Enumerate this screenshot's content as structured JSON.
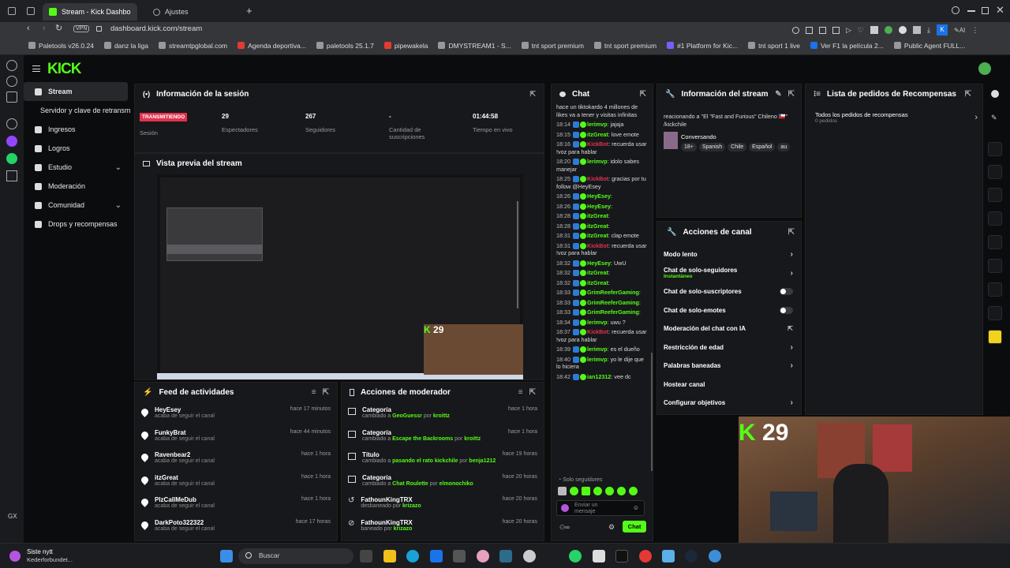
{
  "browser": {
    "tabs": [
      {
        "label": "Stream - Kick Dashbo"
      },
      {
        "label": "Ajustes"
      }
    ],
    "url": "dashboard.kick.com/stream",
    "vpn": "VPN",
    "bookmarks": [
      "Paletools v26.0.24",
      "danz la liga",
      "streamtpglobal.com",
      "Agenda deportiva...",
      "paletools 25.1.7",
      "pipewakela",
      "DMYSTREAM1 - S...",
      "tnt sport premium",
      "tnt sport premium",
      "#1 Platform for Kic...",
      "tnt sport 1 live",
      "Ver F1 la película 2...",
      "Public Agent FULL..."
    ]
  },
  "sidebar": {
    "logo": "KICK",
    "items": [
      {
        "label": "Stream"
      },
      {
        "label": "Servidor y clave de retransmi"
      },
      {
        "label": "Ingresos"
      },
      {
        "label": "Logros"
      },
      {
        "label": "Estudio"
      },
      {
        "label": "Moderación"
      },
      {
        "label": "Comunidad"
      },
      {
        "label": "Drops y recompensas"
      }
    ]
  },
  "session": {
    "title": "Información de la sesión",
    "status": "TRANSMITIENDO",
    "status_label": "Sesión",
    "viewers": "29",
    "viewers_label": "Espectadores",
    "followers": "267",
    "followers_label": "Seguidores",
    "subs": "-",
    "subs_label": "Cantidad de suscripciones",
    "time": "01:44:58",
    "time_label": "Tiempo en vivo"
  },
  "preview": {
    "title": "Vista previa del stream",
    "viewer_count": "29"
  },
  "feed": {
    "title": "Feed de actividades",
    "rows": [
      {
        "name": "HeyEsey",
        "sub": "acaba de seguir el canal",
        "time": "hace 17 minutos"
      },
      {
        "name": "FunkyBrat",
        "sub": "acaba de seguir el canal",
        "time": "hace 44 minutos"
      },
      {
        "name": "Ravenbear2",
        "sub": "acaba de seguir el canal",
        "time": "hace 1 hora"
      },
      {
        "name": "itzGreat",
        "sub": "acaba de seguir el canal",
        "time": "hace 1 hora"
      },
      {
        "name": "PlzCallMeDub",
        "sub": "acaba de seguir el canal",
        "time": "hace 1 hora"
      },
      {
        "name": "DarkPoto322322",
        "sub": "acaba de seguir el canal",
        "time": "hace 17 horas"
      }
    ]
  },
  "modactions": {
    "title": "Acciones de moderador",
    "rows": [
      {
        "title": "Categoría",
        "pre": "cambiado a ",
        "obj": "GeoGuessr",
        "mid": " por ",
        "by": "kroittz",
        "time": "hace 1 hora"
      },
      {
        "title": "Categoría",
        "pre": "cambiado a ",
        "obj": "Escape the Backrooms",
        "mid": " por ",
        "by": "kroittz",
        "time": "hace 1 hora"
      },
      {
        "title": "Título",
        "pre": "cambiado a ",
        "obj": "pasando el rato kickchile",
        "mid": " por ",
        "by": "benja1212",
        "time": "hace 19 horas"
      },
      {
        "title": "Categoría",
        "pre": "cambiado a ",
        "obj": "Chat Roulette",
        "mid": " por ",
        "by": "elmonochiko",
        "time": "hace 20 horas"
      },
      {
        "title": "FathounKingTRX",
        "pre": "desbaneado por ",
        "obj": "krizazo",
        "mid": "",
        "by": "",
        "time": "hace 20 horas"
      },
      {
        "title": "FathounKingTRX",
        "pre": "baneado por ",
        "obj": "krizazo",
        "mid": "",
        "by": "",
        "time": "hace 20 horas"
      }
    ]
  },
  "chat": {
    "title": "Chat",
    "top": "hace un tiktokardo 4 millones de likes va a tener y visitas infinitas",
    "lines": [
      {
        "t": "18:14",
        "u": "lerimvp",
        "m": ": jajaja",
        "red": false
      },
      {
        "t": "18:15",
        "u": "itzGreat",
        "m": ": love emote",
        "red": false
      },
      {
        "t": "18:16",
        "u": "KickBot",
        "m": ": recuerda usar !voz para hablar",
        "red": true
      },
      {
        "t": "18:20",
        "u": "lerimvp",
        "m": ": idolo sabes manejar",
        "red": false
      },
      {
        "t": "18:25",
        "u": "KickBot",
        "m": ": gracias por tu follow @HeyEsey",
        "red": true
      },
      {
        "t": "18:26",
        "u": "HeyEsey",
        "m": ":",
        "red": false
      },
      {
        "t": "18:26",
        "u": "HeyEsey",
        "m": ":",
        "red": false
      },
      {
        "t": "18:28",
        "u": "itzGreat",
        "m": ":",
        "red": false
      },
      {
        "t": "18:28",
        "u": "itzGreat",
        "m": ":",
        "red": false
      },
      {
        "t": "18:31",
        "u": "itzGreat",
        "m": ": clap emote",
        "red": false
      },
      {
        "t": "18:31",
        "u": "KickBot",
        "m": ": recuerda usar !voz para hablar",
        "red": true
      },
      {
        "t": "18:32",
        "u": "HeyEsey",
        "m": ": UwU",
        "red": false
      },
      {
        "t": "18:32",
        "u": "itzGreat",
        "m": ":",
        "red": false
      },
      {
        "t": "18:32",
        "u": "itzGreat",
        "m": ":",
        "red": false
      },
      {
        "t": "18:33",
        "u": "GrimReeferGaming",
        "m": ":",
        "red": false
      },
      {
        "t": "18:33",
        "u": "GrimReeferGaming",
        "m": ":",
        "red": false
      },
      {
        "t": "18:33",
        "u": "GrimReeferGaming",
        "m": ":",
        "red": false
      },
      {
        "t": "18:34",
        "u": "lerimvp",
        "m": ": uwu ?",
        "red": false
      },
      {
        "t": "18:37",
        "u": "KickBot",
        "m": ": recuerda usar !voz para hablar",
        "red": true
      },
      {
        "t": "18:39",
        "u": "lerimvp",
        "m": ": es el dueño",
        "red": false
      },
      {
        "t": "18:40",
        "u": "lerimvp",
        "m": ": yo le dije que lo hiciera",
        "red": false
      },
      {
        "t": "18:42",
        "u": "ian12312",
        "m": ": vee dc",
        "red": false
      }
    ],
    "mode": "Solo seguidores",
    "placeholder": "Enviar un mensaje",
    "send": "Chat"
  },
  "streaminfo": {
    "title": "Información del stream",
    "stream_title": "reacionando a \"El \"Fast and Furious\" Chileno 🇨🇱\" /kickchile",
    "category": "Conversando",
    "tags": [
      "18+",
      "Spanish",
      "Chile",
      "Español",
      "au"
    ]
  },
  "rewards": {
    "title": "Lista de pedidos de Recompensas",
    "item": "Todos los pedidos de recompensas",
    "count": "0 pedidos"
  },
  "channel": {
    "title": "Acciones de canal",
    "rows": [
      {
        "label": "Modo lento",
        "type": "chev"
      },
      {
        "label": "Chat de solo-seguidores",
        "sub": "Instantáneo",
        "type": "chev"
      },
      {
        "label": "Chat de solo-suscriptores",
        "type": "toggle"
      },
      {
        "label": "Chat de solo-emotes",
        "type": "toggle"
      },
      {
        "label": "Moderación del chat con IA",
        "type": "ext"
      },
      {
        "label": "Restricción de edad",
        "type": "chev"
      },
      {
        "label": "Palabras baneadas",
        "type": "chev"
      },
      {
        "label": "Hostear canal",
        "type": "none"
      },
      {
        "label": "Configurar objetivos",
        "type": "chev"
      }
    ]
  },
  "webcam": {
    "count": "29"
  },
  "taskbar": {
    "notif_title": "Siste nytt",
    "notif_sub": "Kederforbundet...",
    "search": "Buscar"
  }
}
